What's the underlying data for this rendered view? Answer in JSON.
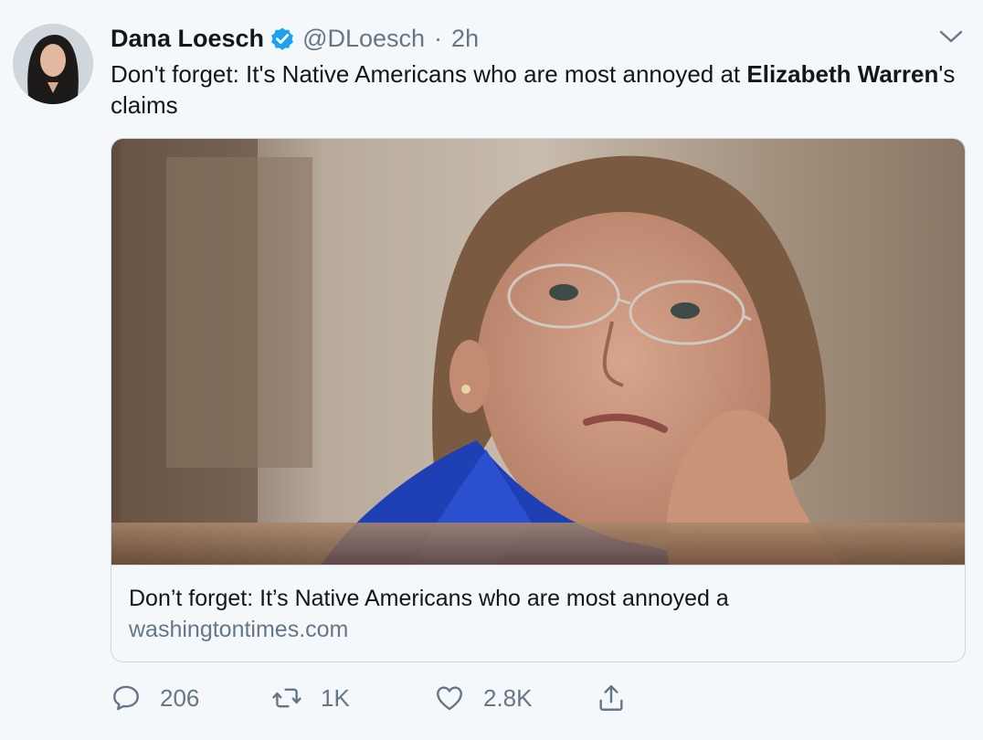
{
  "tweet": {
    "display_name": "Dana Loesch",
    "handle": "@DLoesch",
    "separator": "·",
    "time": "2h",
    "verified_icon": "verified-badge-icon",
    "text_parts": {
      "part1": "Don't forget: It's Native Americans who are most annoyed at ",
      "bold1": "Elizabeth Warren",
      "part2": "'s claims"
    }
  },
  "card": {
    "title": "Don’t forget: It’s Native Americans who are most annoyed a",
    "domain": "washingtontimes.com"
  },
  "actions": {
    "reply_count": "206",
    "retweet_count": "1K",
    "like_count": "2.8K"
  },
  "colors": {
    "background": "#f5f8fa",
    "verified": "#1da1f2",
    "secondary_text": "#657786",
    "border": "#ccd6dd"
  }
}
